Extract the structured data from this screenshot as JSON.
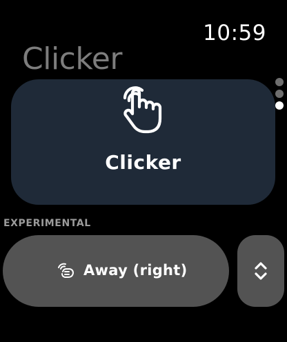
{
  "status_bar": {
    "time": "10:59"
  },
  "header": {
    "title": "Clicker"
  },
  "pager": {
    "page_count": 3,
    "current_page": 3
  },
  "main_card": {
    "label": "Clicker",
    "icon": "hand-tap-icon"
  },
  "experimental": {
    "section_title": "EXPERIMENTAL",
    "away_button": {
      "label": "Away (right)",
      "icon": "wrist-gesture-icon"
    },
    "stepper_button": {
      "icon": "chevron-up-down-icon"
    }
  },
  "colors": {
    "background": "#000000",
    "card": "#1f2a38",
    "button": "#535353",
    "title_gray": "#7d7d7d"
  }
}
